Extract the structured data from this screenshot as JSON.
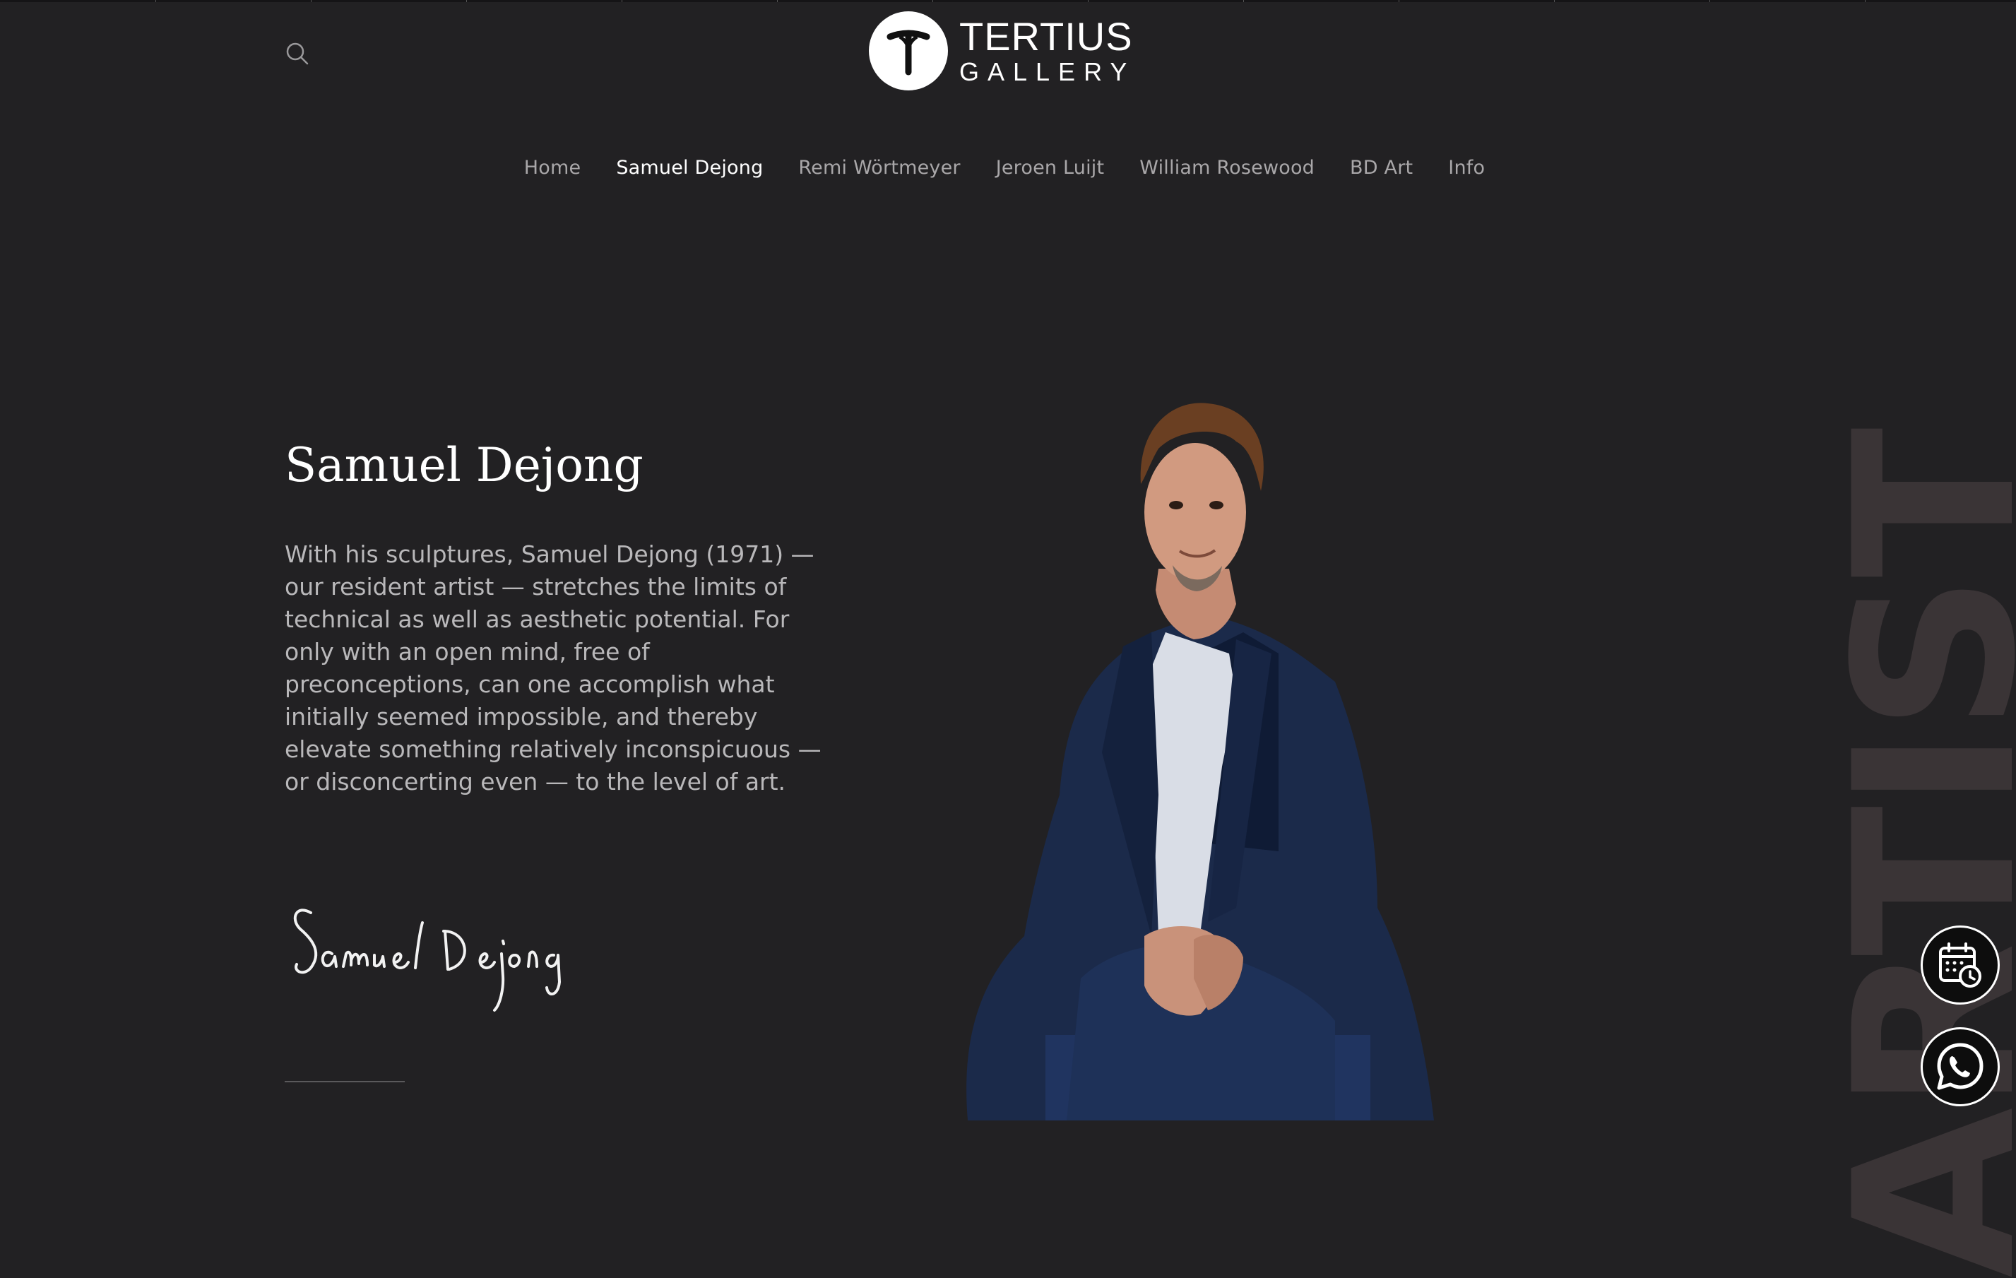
{
  "brand": {
    "top": "TERTIUS",
    "bottom": "GALLERY"
  },
  "nav": {
    "items": [
      "Home",
      "Samuel Dejong",
      "Remi Wörtmeyer",
      "Jeroen Luijt",
      "William Rosewood",
      "BD Art",
      "Info"
    ],
    "active": "Samuel Dejong"
  },
  "artist": {
    "name": "Samuel Dejong",
    "bio": "With his sculptures, Samuel Dejong (1971) — our resident artist — stretches the limits of technical as well as aesthetic potential. For only with an open mind, free of preconceptions, can one accomplish what initially seemed impossible, and thereby elevate something relatively inconspicuous — or disconcerting even — to the level of art.",
    "signature": "Samuel Dejong",
    "side_word": "ARTIST"
  },
  "icons": {
    "search": "search-icon",
    "calendar": "calendar-clock-icon",
    "whatsapp": "whatsapp-icon"
  },
  "colors": {
    "background": "#222123",
    "text_primary": "#ffffff",
    "text_muted": "#b9b8ba",
    "side_word": "#3a3436"
  }
}
